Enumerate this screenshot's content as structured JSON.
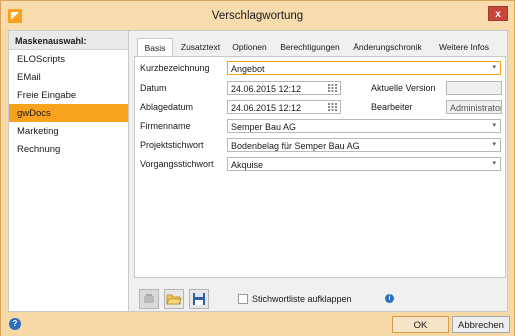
{
  "window": {
    "title": "Verschlagwortung"
  },
  "sidebar": {
    "header": "Maskenauswahl:",
    "items": [
      {
        "label": "ELOScripts"
      },
      {
        "label": "EMail"
      },
      {
        "label": "Freie Eingabe"
      },
      {
        "label": "gwDocs",
        "active": true
      },
      {
        "label": "Marketing"
      },
      {
        "label": "Rechnung"
      }
    ]
  },
  "tabs": [
    {
      "label": "Basis",
      "active": true
    },
    {
      "label": "Zusatztext"
    },
    {
      "label": "Optionen"
    },
    {
      "label": "Berechtigungen"
    },
    {
      "label": "Änderungschronik"
    },
    {
      "label": "Weitere Infos"
    }
  ],
  "form": {
    "kurzbezeichnung": {
      "label": "Kurzbezeichnung",
      "value": "Angebot"
    },
    "datum": {
      "label": "Datum",
      "value": "24.06.2015 12:12"
    },
    "aktuelle_version": {
      "label": "Aktuelle Version",
      "value": ""
    },
    "ablagedatum": {
      "label": "Ablagedatum",
      "value": "24.06.2015 12:12"
    },
    "bearbeiter": {
      "label": "Bearbeiter",
      "value": "Administrator"
    },
    "firmenname": {
      "label": "Firmenname",
      "value": "Semper Bau AG"
    },
    "projektstichwort": {
      "label": "Projektstichwort",
      "value": "Bodenbelag für Semper Bau AG"
    },
    "vorgangsstichwort": {
      "label": "Vorgangsstichwort",
      "value": "Akquise"
    }
  },
  "bottom": {
    "checkbox_label": "Stichwortliste aufklappen"
  },
  "footer": {
    "ok_label": "OK",
    "cancel_label": "Abbrechen"
  },
  "icons": {
    "app": "elo-app-icon",
    "close": "close-icon",
    "calendar": "calendar-icon",
    "dropdown": "chevron-down-icon",
    "tool1": "keyword-icon",
    "tool2": "open-folder-icon",
    "tool3": "save-icon",
    "info": "info-icon",
    "help": "help-icon"
  },
  "colors": {
    "accent": "#f9a21d",
    "titlebar": "#f8dcae",
    "close": "#c9463d"
  }
}
